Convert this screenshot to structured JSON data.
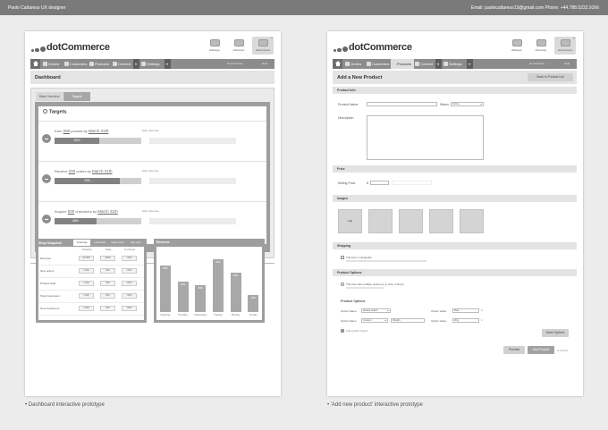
{
  "header": {
    "author": "Paolo Caltareso UX designer",
    "contact": "Email: paolocaltareso13@gmail.com Phone: +44.788.5232.9166"
  },
  "captions": {
    "dashboard": "• Dashboard interactive prototype",
    "add_product": "• 'Add new product' interactive prototype"
  },
  "app": {
    "logo": "dotCommerce",
    "app_icons": [
      "dotKeeper",
      "dotContact",
      "dotCommerce"
    ],
    "selected_app": "dotCommerce",
    "user_menu": "Hi username",
    "help": "Help"
  },
  "dashboard": {
    "nav": [
      "Orders",
      "Customers",
      "Products",
      "Content",
      "Settings"
    ],
    "page_title": "Dashboard",
    "tabs": [
      "Stats Overview",
      "Targets"
    ],
    "active_tab": "Targets",
    "targets_title": "Targets",
    "edit_remove": "Edit | Remove",
    "targets": [
      {
        "prefix": "Earn",
        "amount": "200",
        "suffix": "pounds by",
        "date": "March 31th",
        "progress": 52,
        "label": "52%"
      },
      {
        "prefix": "Receive",
        "amount": "200",
        "suffix": "orders by",
        "date": "March 31th",
        "progress": 75,
        "label": "75%"
      },
      {
        "prefix": "Acquire",
        "amount": "500",
        "suffix": "customers by",
        "date": "March 31th",
        "progress": 48,
        "label": "48%"
      }
    ],
    "snapshot": {
      "title": "Shop Snapshot",
      "tabs": [
        "Yesterday",
        "Last week",
        "Last month",
        "Last year"
      ],
      "active_tab": "Yesterday",
      "columns": [
        "Yesterday",
        "Today",
        "% Change"
      ],
      "rows": [
        {
          "label": "Revenue",
          "values": [
            "£1,000",
            "£500",
            "-50%"
          ]
        },
        {
          "label": "New orders",
          "values": [
            "1,000",
            "500",
            "-50%"
          ]
        },
        {
          "label": "Product Sold",
          "values": [
            "1,000",
            "500",
            "-50%"
          ]
        },
        {
          "label": "Total Customers",
          "values": [
            "1,000",
            "500",
            "-50%"
          ]
        },
        {
          "label": "New Customers",
          "values": [
            "1,000",
            "500",
            "-50%"
          ]
        }
      ]
    },
    "revenue": {
      "title": "Revenue",
      "chart_data": {
        "type": "bar",
        "categories": [
          "Yesterday",
          "Thursday",
          "Wednesday",
          "Tuesday",
          "Monday",
          "Sunday"
        ],
        "values": [
          350,
          230,
          200,
          400,
          300,
          130
        ],
        "labels": [
          "350k",
          "230k",
          "200k",
          "400k",
          "300k",
          "130k"
        ],
        "ylim": [
          0,
          420
        ]
      }
    }
  },
  "add_product": {
    "nav": [
      "Orders",
      "Customers",
      "Products",
      "Content",
      "Settings"
    ],
    "active_nav": "Products",
    "page_title": "Add a New Product",
    "back_button": "Back to Product List",
    "product_info": {
      "title": "Product Info",
      "name_label": "Product Name",
      "status_label": "Status",
      "status_value": "Active",
      "description_label": "Description"
    },
    "price": {
      "title": "Price",
      "selling_label": "Selling Price",
      "currency": "$"
    },
    "images": {
      "title": "Images",
      "add_label": "Add"
    },
    "shipping": {
      "title": "Shipping",
      "checkbox_label": "This item is shippable"
    },
    "options": {
      "title": "Product Options",
      "radio_label": "This item has multiple options (e.g. Size, Colour)",
      "sub_title": "Product Options",
      "option_name_label": "Option Name",
      "option_value_label": "Option Value",
      "option1_name": "please select",
      "option1_value": "Red",
      "option2_name": "Custom",
      "option2_custom": "Weight",
      "option2_value": "2Kg",
      "add_option": "Add another Option",
      "save_options": "Save Options"
    },
    "actions": {
      "preview": "Preview",
      "add": "Add Product",
      "cancel": "or Cancel"
    }
  }
}
